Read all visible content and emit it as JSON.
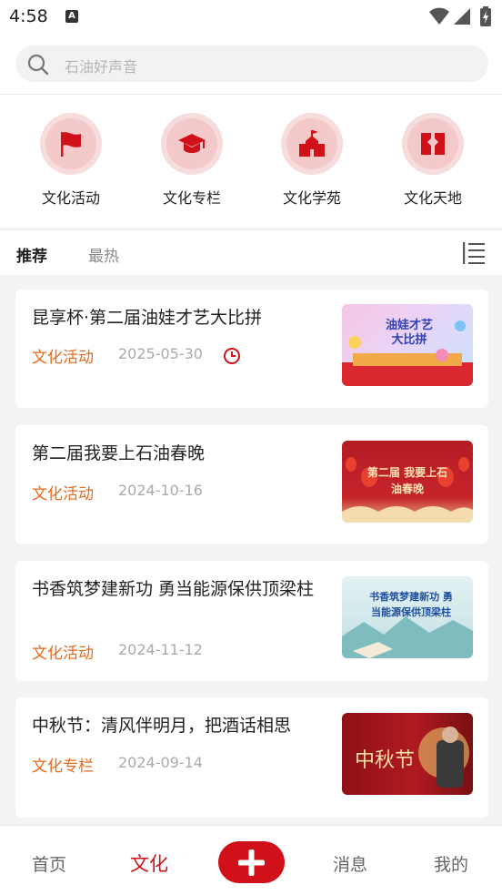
{
  "status": {
    "time": "4:58"
  },
  "search": {
    "placeholder": "石油好声音"
  },
  "categories": [
    {
      "label": "文化活动",
      "icon": "flag-icon"
    },
    {
      "label": "文化专栏",
      "icon": "graduation-cap-icon"
    },
    {
      "label": "文化学苑",
      "icon": "school-building-icon"
    },
    {
      "label": "文化天地",
      "icon": "open-book-icon"
    }
  ],
  "tabs": {
    "active": "推荐",
    "inactive": "最热"
  },
  "articles": [
    {
      "title": "昆享杯·第二届油娃才艺大比拼",
      "category": "文化活动",
      "date": "2025-05-30",
      "thumb_text": "油娃才艺大比拼"
    },
    {
      "title": "第二届我要上石油春晚",
      "category": "文化活动",
      "date": "2024-10-16",
      "thumb_text": "第二届 我要上石油春晚"
    },
    {
      "title": "书香筑梦建新功 勇当能源保供顶梁柱",
      "category": "文化活动",
      "date": "2024-11-12",
      "thumb_text": "书香筑梦建新功 勇当能源保供顶梁柱"
    },
    {
      "title": "中秋节：清风伴明月，把酒话相思",
      "category": "文化专栏",
      "date": "2024-09-14",
      "thumb_text": "中秋节"
    }
  ],
  "nav": {
    "home": "首页",
    "culture": "文化",
    "messages": "消息",
    "mine": "我的"
  },
  "colors": {
    "accent": "#d0111a",
    "tag": "#e76a1b",
    "active_nav": "#c8151b"
  }
}
